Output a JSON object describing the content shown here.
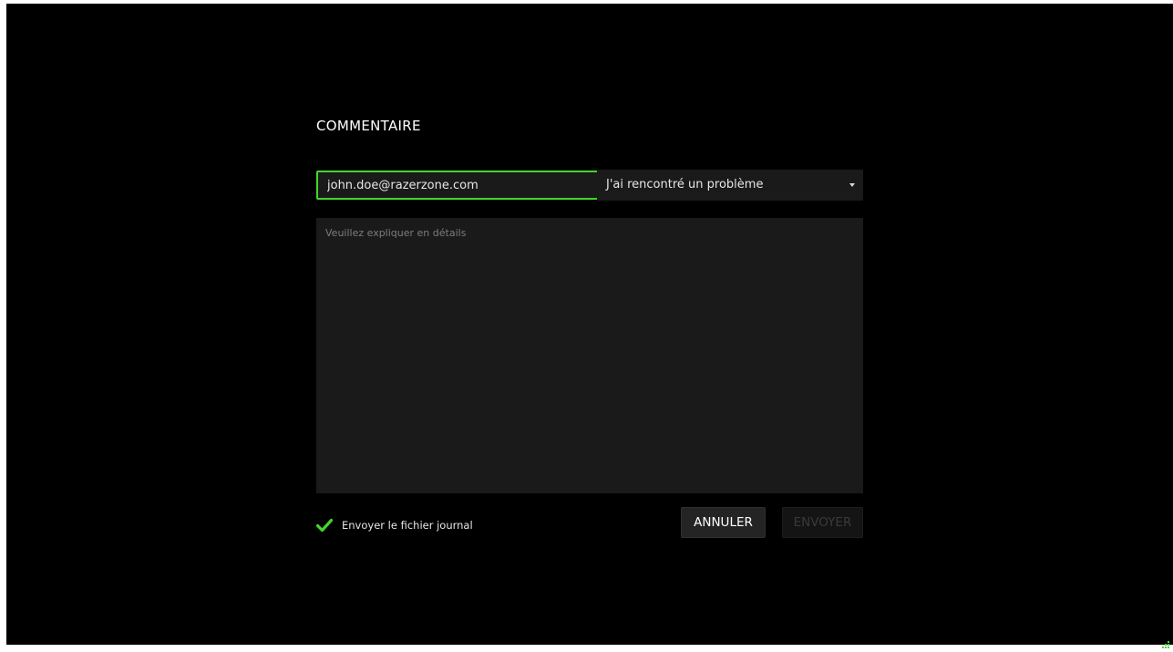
{
  "dialog": {
    "title": "COMMENTAIRE",
    "email": {
      "value": "john.doe@razerzone.com"
    },
    "category": {
      "selected": "J'ai rencontré un problème"
    },
    "details": {
      "placeholder": "Veuillez expliquer en détails"
    },
    "send_log": {
      "checked": true,
      "label": "Envoyer le fichier journal"
    },
    "buttons": {
      "cancel_label": "ANNULER",
      "send_label": "ENVOYER"
    }
  },
  "icons": {
    "checkbox": "check-icon",
    "dropdown": "caret-down-icon",
    "resize": "resize-grip-icon"
  },
  "colors": {
    "accent": "#44d62c",
    "background": "#000000",
    "field_background": "#1a1a1a",
    "disabled_text": "#3a3a3a"
  }
}
